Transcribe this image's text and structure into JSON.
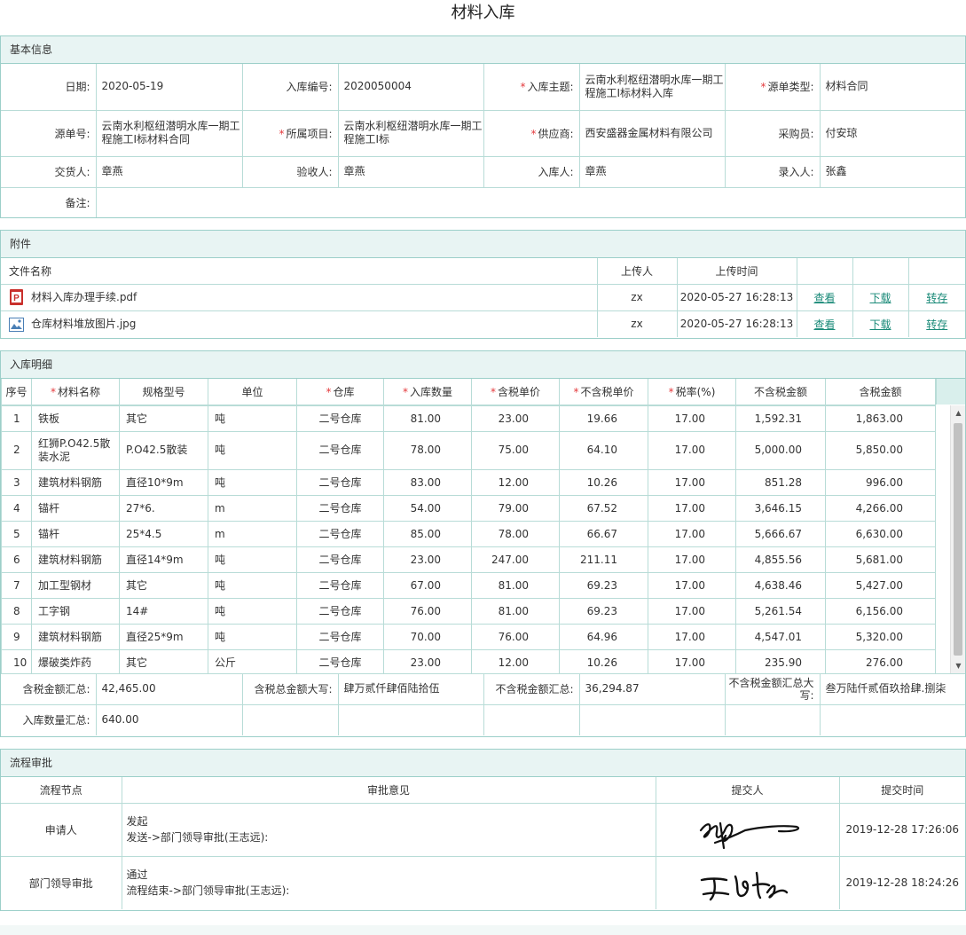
{
  "page": {
    "title": "材料入库"
  },
  "basic": {
    "heading": "基本信息",
    "date_label": "日期:",
    "date": "2020-05-19",
    "code_label": "入库编号:",
    "code": "2020050004",
    "subject_label": "入库主题:",
    "subject": "云南水利枢纽潜明水库一期工程施工I标材料入库",
    "src_type_label": "源单类型:",
    "src_type": "材料合同",
    "src_no_label": "源单号:",
    "src_no": "云南水利枢纽潜明水库一期工程施工I标材料合同",
    "project_label": "所属项目:",
    "project": "云南水利枢纽潜明水库一期工程施工I标",
    "supplier_label": "供应商:",
    "supplier": "西安盛器金属材料有限公司",
    "buyer_label": "采购员:",
    "buyer": "付安琼",
    "deliver_label": "交货人:",
    "deliver": "章燕",
    "checker_label": "验收人:",
    "checker": "章燕",
    "stocker_label": "入库人:",
    "stocker": "章燕",
    "entry_label": "录入人:",
    "entry": "张鑫",
    "remark_label": "备注:",
    "remark": ""
  },
  "attachments": {
    "heading": "附件",
    "col_name": "文件名称",
    "col_uploader": "上传人",
    "col_time": "上传时间",
    "view_label": "查看",
    "download_label": "下载",
    "save_label": "转存",
    "files": [
      {
        "name": "材料入库办理手续.pdf",
        "type": "pdf-icon",
        "uploader": "zx",
        "time": "2020-05-27 16:28:13"
      },
      {
        "name": "仓库材料堆放图片.jpg",
        "type": "image-icon",
        "uploader": "zx",
        "time": "2020-05-27 16:28:13"
      }
    ]
  },
  "detail": {
    "heading": "入库明细",
    "columns": [
      "序号",
      "材料名称",
      "规格型号",
      "单位",
      "仓库",
      "入库数量",
      "含税单价",
      "不含税单价",
      "税率(%)",
      "不含税金额",
      "含税金额"
    ],
    "rows": [
      [
        "1",
        "铁板",
        "其它",
        "吨",
        "二号仓库",
        "81.00",
        "23.00",
        "19.66",
        "17.00",
        "1,592.31",
        "1,863.00"
      ],
      [
        "2",
        "红狮P.O42.5散装水泥",
        "P.O42.5散装",
        "吨",
        "二号仓库",
        "78.00",
        "75.00",
        "64.10",
        "17.00",
        "5,000.00",
        "5,850.00"
      ],
      [
        "3",
        "建筑材料钢筋",
        "直径10*9m",
        "吨",
        "二号仓库",
        "83.00",
        "12.00",
        "10.26",
        "17.00",
        "851.28",
        "996.00"
      ],
      [
        "4",
        "锚杆",
        "27*6.",
        "m",
        "二号仓库",
        "54.00",
        "79.00",
        "67.52",
        "17.00",
        "3,646.15",
        "4,266.00"
      ],
      [
        "5",
        "锚杆",
        "25*4.5",
        "m",
        "二号仓库",
        "85.00",
        "78.00",
        "66.67",
        "17.00",
        "5,666.67",
        "6,630.00"
      ],
      [
        "6",
        "建筑材料钢筋",
        "直径14*9m",
        "吨",
        "二号仓库",
        "23.00",
        "247.00",
        "211.11",
        "17.00",
        "4,855.56",
        "5,681.00"
      ],
      [
        "7",
        "加工型钢材",
        "其它",
        "吨",
        "二号仓库",
        "67.00",
        "81.00",
        "69.23",
        "17.00",
        "4,638.46",
        "5,427.00"
      ],
      [
        "8",
        "工字钢",
        "14#",
        "吨",
        "二号仓库",
        "76.00",
        "81.00",
        "69.23",
        "17.00",
        "5,261.54",
        "6,156.00"
      ],
      [
        "9",
        "建筑材料钢筋",
        "直径25*9m",
        "吨",
        "二号仓库",
        "70.00",
        "76.00",
        "64.96",
        "17.00",
        "4,547.01",
        "5,320.00"
      ],
      [
        "10",
        "爆破类炸药",
        "其它",
        "公斤",
        "二号仓库",
        "23.00",
        "12.00",
        "10.26",
        "17.00",
        "235.90",
        "276.00"
      ]
    ],
    "sum": {
      "tax_total_label": "含税金额汇总:",
      "tax_total": "42,465.00",
      "tax_upper_label": "含税总金额大写:",
      "tax_upper": "肆万贰仟肆佰陆拾伍",
      "notax_total_label": "不含税金额汇总:",
      "notax_total": "36,294.87",
      "notax_upper_label": "不含税金额汇总大写:",
      "notax_upper": "叁万陆仟贰佰玖拾肆.捌柒",
      "qty_label": "入库数量汇总:",
      "qty": "640.00"
    }
  },
  "flow": {
    "heading": "流程审批",
    "col_node": "流程节点",
    "col_opinion": "审批意见",
    "col_submitter": "提交人",
    "col_time": "提交时间",
    "rows": [
      {
        "node": "申请人",
        "opinion1": "发起",
        "opinion2": "发送->部门领导审批(王志远):",
        "time": "2019-12-28 17:26:06"
      },
      {
        "node": "部门领导审批",
        "opinion1": "通过",
        "opinion2": "流程结束->部门领导审批(王志远):",
        "time": "2019-12-28 18:24:26"
      }
    ]
  }
}
